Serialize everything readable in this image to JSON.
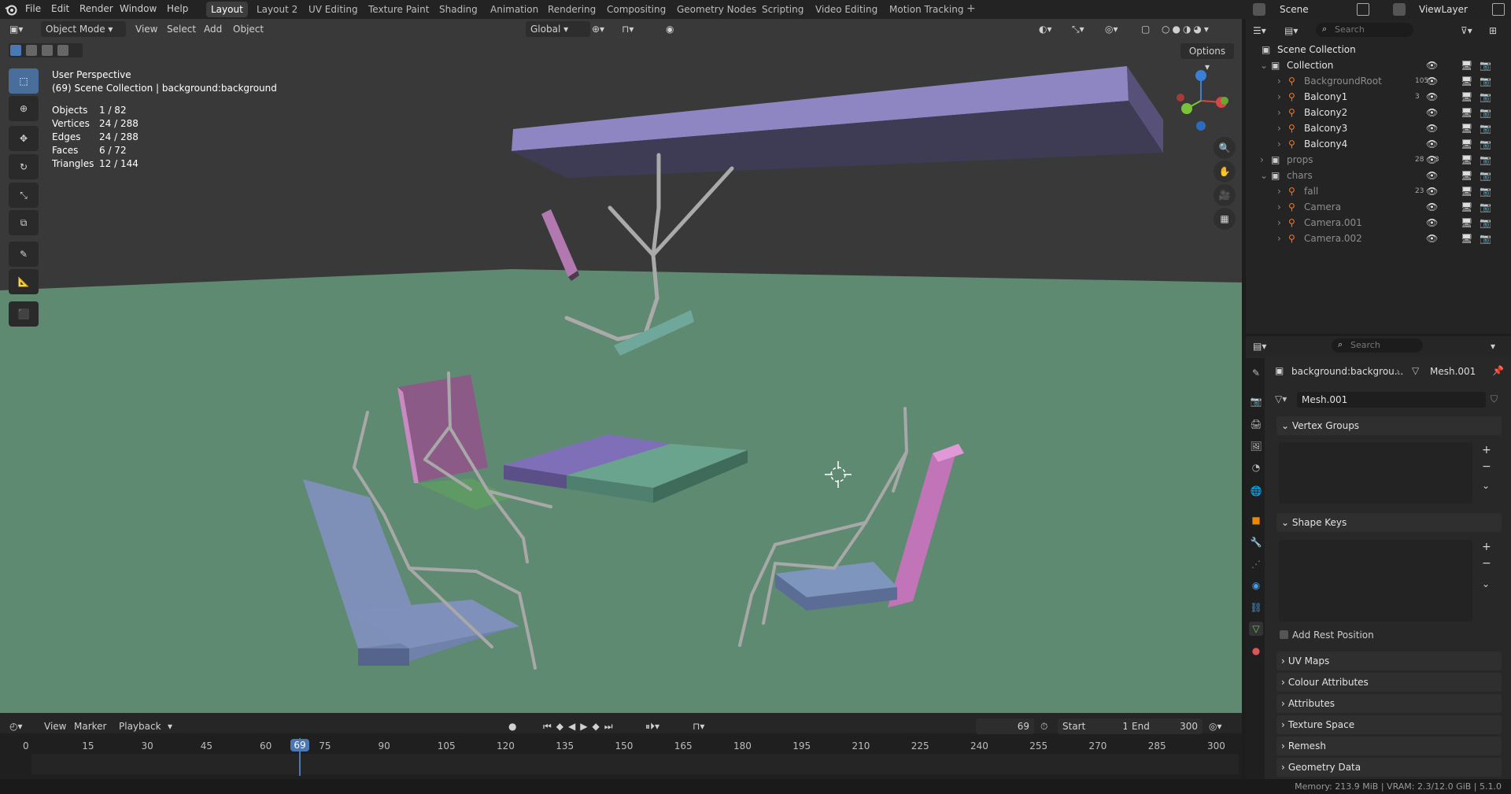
{
  "app": {
    "menu": [
      "File",
      "Edit",
      "Render",
      "Window",
      "Help"
    ],
    "workspaces": [
      "Layout",
      "Layout 2",
      "UV Editing",
      "Texture Paint",
      "Shading",
      "Animation",
      "Rendering",
      "Compositing",
      "Geometry Nodes",
      "Scripting",
      "Video Editing",
      "Motion Tracking"
    ],
    "active_workspace": "Layout",
    "scene_name": "Scene",
    "view_layer": "ViewLayer"
  },
  "viewport_header": {
    "mode": "Object Mode",
    "menus": [
      "View",
      "Select",
      "Add",
      "Object"
    ],
    "orientation": "Global",
    "options_label": "Options"
  },
  "overlay": {
    "perspective": "User Perspective",
    "collection_line": "(69) Scene Collection | background:background",
    "stats": [
      {
        "label": "Objects",
        "value": "1 / 82"
      },
      {
        "label": "Vertices",
        "value": "24 / 288"
      },
      {
        "label": "Edges",
        "value": "24 / 288"
      },
      {
        "label": "Faces",
        "value": "6 / 72"
      },
      {
        "label": "Triangles",
        "value": "12 / 144"
      }
    ]
  },
  "outliner": {
    "search_placeholder": "Search",
    "root": "Scene Collection",
    "rows": [
      {
        "label": "Collection",
        "indent": 1
      },
      {
        "label": "BackgroundRoot",
        "indent": 2,
        "dim": true,
        "badge": "105"
      },
      {
        "label": "Balcony1",
        "indent": 2,
        "badge": "3"
      },
      {
        "label": "Balcony2",
        "indent": 2
      },
      {
        "label": "Balcony3",
        "indent": 2
      },
      {
        "label": "Balcony4",
        "indent": 2
      },
      {
        "label": "props",
        "indent": 1,
        "dim": true,
        "badge": "28",
        "badge2": "3"
      },
      {
        "label": "chars",
        "indent": 1,
        "dim": true
      },
      {
        "label": "fall",
        "indent": 2,
        "dim": true,
        "badge": "23"
      },
      {
        "label": "Camera",
        "indent": 2,
        "dim": true
      },
      {
        "label": "Camera.001",
        "indent": 2,
        "dim": true
      },
      {
        "label": "Camera.002",
        "indent": 2,
        "dim": true
      }
    ]
  },
  "properties": {
    "search_placeholder": "Search",
    "breadcrumb_object": "background:backgrou...",
    "breadcrumb_mesh": "Mesh.001",
    "mesh_name": "Mesh.001",
    "panels_open": [
      "Vertex Groups",
      "Shape Keys"
    ],
    "add_rest_position": "Add Rest Position",
    "panels_closed": [
      "UV Maps",
      "Colour Attributes",
      "Attributes",
      "Texture Space",
      "Remesh",
      "Geometry Data"
    ]
  },
  "timeline": {
    "menus": [
      "View",
      "Marker",
      "Playback"
    ],
    "current_frame": "69",
    "start_label": "Start",
    "start": "1",
    "end_label": "End",
    "end": "300",
    "ticks": [
      "0",
      "15",
      "30",
      "45",
      "60",
      "75",
      "90",
      "105",
      "120",
      "135",
      "150",
      "165",
      "180",
      "195",
      "210",
      "225",
      "240",
      "255",
      "270",
      "285",
      "300"
    ]
  },
  "status": {
    "memory": "Memory: 213.9 MiB | VRAM: 2.3/12.0 GiB | 5.1.0"
  },
  "colors": {
    "accent": "#4a78b4",
    "ground": "#5f8a72",
    "sky": "#393939"
  }
}
